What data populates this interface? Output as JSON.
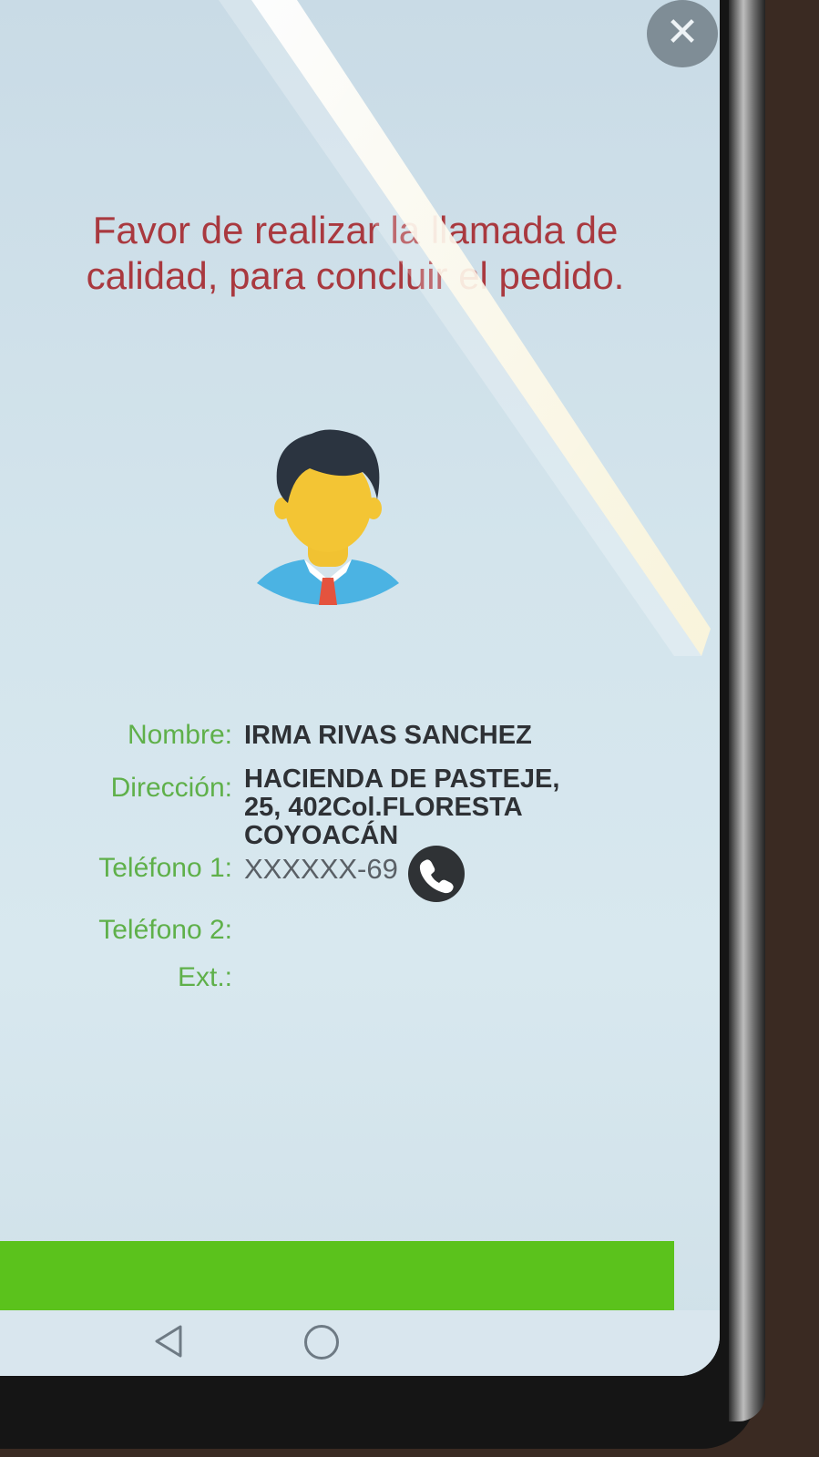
{
  "dialog": {
    "close_label": "✕",
    "message": "Favor de realizar la llamada de calidad, para concluir el pedido."
  },
  "customer": {
    "name_label": "Nombre:",
    "name_value": "IRMA RIVAS SANCHEZ",
    "address_label": "Dirección:",
    "address_lines": [
      "HACIENDA DE PASTEJE,",
      "25, 402Col.FLORESTA",
      "COYOACÁN"
    ],
    "phone1_label": "Teléfono 1:",
    "phone1_value": "XXXXXX-69",
    "phone2_label": "Teléfono 2:",
    "phone2_value": "",
    "ext_label": "Ext.:",
    "ext_value": ""
  },
  "icons": {
    "close": "close-icon",
    "avatar": "user-avatar-icon",
    "call": "phone-icon",
    "nav_back": "back-triangle-icon",
    "nav_home": "home-circle-icon"
  },
  "colors": {
    "message": "#a9393f",
    "label": "#5fb04a",
    "value": "#2e3135",
    "action_bar": "#5bc21c"
  }
}
